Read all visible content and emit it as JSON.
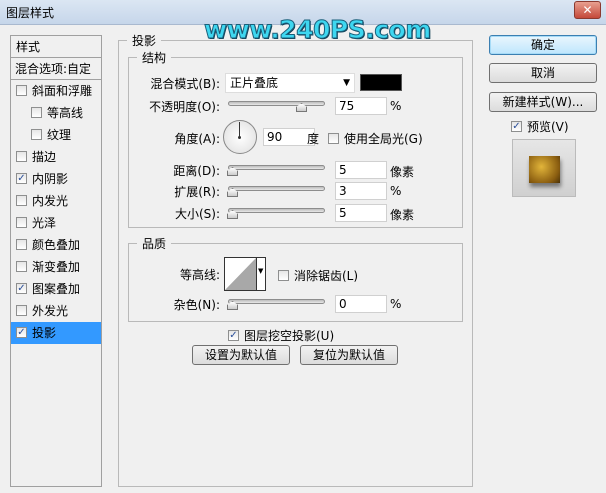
{
  "window": {
    "title": "图层样式",
    "close": "✕"
  },
  "watermark": "www.240PS.com",
  "left": {
    "header": "样式",
    "blend_options": "混合选项:自定",
    "items": [
      {
        "label": "斜面和浮雕",
        "checked": false
      },
      {
        "label": "等高线",
        "checked": false
      },
      {
        "label": "纹理",
        "checked": false
      },
      {
        "label": "描边",
        "checked": false
      },
      {
        "label": "内阴影",
        "checked": true
      },
      {
        "label": "内发光",
        "checked": false
      },
      {
        "label": "光泽",
        "checked": false
      },
      {
        "label": "颜色叠加",
        "checked": false
      },
      {
        "label": "渐变叠加",
        "checked": false
      },
      {
        "label": "图案叠加",
        "checked": true
      },
      {
        "label": "外发光",
        "checked": false
      },
      {
        "label": "投影",
        "checked": true,
        "selected": true
      }
    ]
  },
  "panel": {
    "title": "投影",
    "structure": {
      "title": "结构",
      "blend_mode_label": "混合模式(B):",
      "blend_mode": "正片叠底",
      "color": "#000000",
      "opacity_label": "不透明度(O):",
      "opacity": "75",
      "opacity_unit": "%",
      "angle_label": "角度(A):",
      "angle": "90",
      "angle_unit": "度",
      "global_light": "使用全局光(G)",
      "distance_label": "距离(D):",
      "distance": "5",
      "distance_unit": "像素",
      "spread_label": "扩展(R):",
      "spread": "3",
      "spread_unit": "%",
      "size_label": "大小(S):",
      "size": "5",
      "size_unit": "像素"
    },
    "quality": {
      "title": "品质",
      "contour_label": "等高线:",
      "antialias": "消除锯齿(L)",
      "noise_label": "杂色(N):",
      "noise": "0",
      "noise_unit": "%"
    },
    "knockout": "图层挖空投影(U)",
    "make_default": "设置为默认值",
    "reset_default": "复位为默认值"
  },
  "right": {
    "ok": "确定",
    "cancel": "取消",
    "new_style": "新建样式(W)...",
    "preview": "预览(V)"
  }
}
